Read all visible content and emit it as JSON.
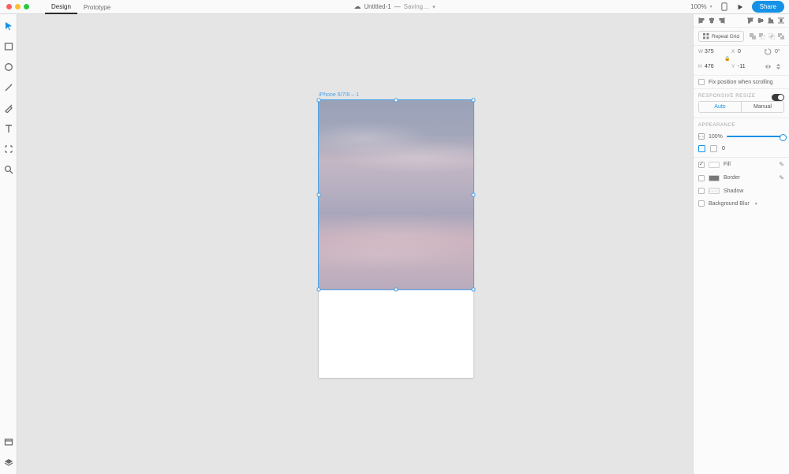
{
  "menubar": {
    "tabs": {
      "design": "Design",
      "prototype": "Prototype"
    },
    "doc_title": "Untitled-1",
    "separator": "—",
    "status": "Saving…",
    "zoom": "100%",
    "share": "Share"
  },
  "canvas": {
    "artboard_label": "iPhone 6/7/8 – 1"
  },
  "inspector": {
    "repeat_grid": "Repeat Grid",
    "transform": {
      "w_label": "W",
      "w": "375",
      "x_label": "X",
      "x": "0",
      "rotation": "0°",
      "h_label": "H",
      "h": "476",
      "y_label": "Y",
      "y": "-11"
    },
    "fix_scroll": "Fix position when scrolling",
    "responsive_title": "Responsive Resize",
    "resize_auto": "Auto",
    "resize_manual": "Manual",
    "appearance_title": "Appearance",
    "opacity_value": "100%",
    "blend_value": "0",
    "fill": "Fill",
    "border": "Border",
    "shadow": "Shadow",
    "bg_blur": "Background Blur"
  }
}
